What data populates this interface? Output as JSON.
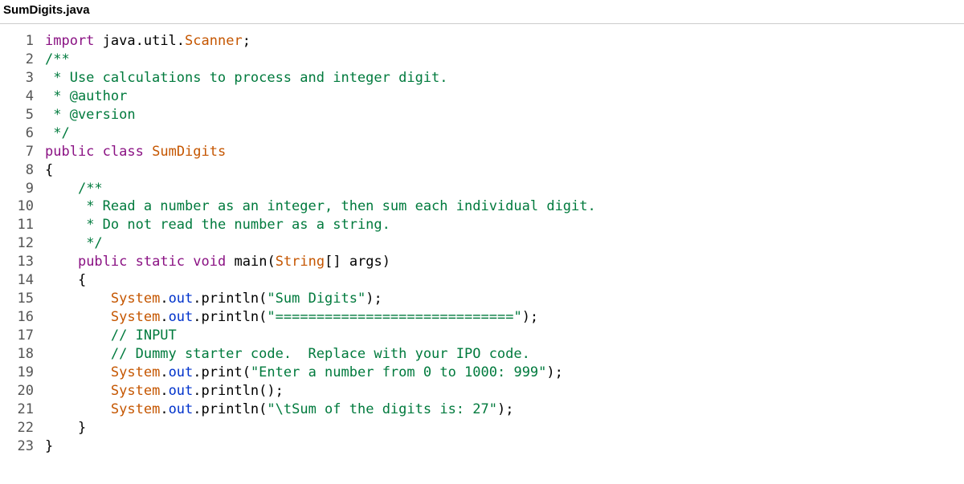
{
  "filename": "SumDigits.java",
  "lines": [
    {
      "n": "1",
      "tokens": [
        {
          "c": "kw",
          "t": "import"
        },
        {
          "c": "punct",
          "t": " "
        },
        {
          "c": "pkg",
          "t": "java.util."
        },
        {
          "c": "cls",
          "t": "Scanner"
        },
        {
          "c": "punct",
          "t": ";"
        }
      ]
    },
    {
      "n": "2",
      "tokens": [
        {
          "c": "comment",
          "t": "/**"
        }
      ]
    },
    {
      "n": "3",
      "tokens": [
        {
          "c": "comment",
          "t": " * Use calculations to process and integer digit."
        }
      ]
    },
    {
      "n": "4",
      "tokens": [
        {
          "c": "comment",
          "t": " * @author"
        }
      ]
    },
    {
      "n": "5",
      "tokens": [
        {
          "c": "comment",
          "t": " * @version"
        }
      ]
    },
    {
      "n": "6",
      "tokens": [
        {
          "c": "comment",
          "t": " */"
        }
      ]
    },
    {
      "n": "7",
      "tokens": [
        {
          "c": "kw",
          "t": "public"
        },
        {
          "c": "punct",
          "t": " "
        },
        {
          "c": "kw",
          "t": "class"
        },
        {
          "c": "punct",
          "t": " "
        },
        {
          "c": "cls",
          "t": "SumDigits"
        }
      ]
    },
    {
      "n": "8",
      "tokens": [
        {
          "c": "punct",
          "t": "{"
        }
      ]
    },
    {
      "n": "9",
      "tokens": [
        {
          "c": "punct",
          "t": "    "
        },
        {
          "c": "comment",
          "t": "/**"
        }
      ]
    },
    {
      "n": "10",
      "tokens": [
        {
          "c": "punct",
          "t": "    "
        },
        {
          "c": "comment",
          "t": " * Read a number as an integer, then sum each individual digit."
        }
      ]
    },
    {
      "n": "11",
      "tokens": [
        {
          "c": "punct",
          "t": "    "
        },
        {
          "c": "comment",
          "t": " * Do not read the number as a string."
        }
      ]
    },
    {
      "n": "12",
      "tokens": [
        {
          "c": "punct",
          "t": "    "
        },
        {
          "c": "comment",
          "t": " */"
        }
      ]
    },
    {
      "n": "13",
      "tokens": [
        {
          "c": "punct",
          "t": "    "
        },
        {
          "c": "kw",
          "t": "public"
        },
        {
          "c": "punct",
          "t": " "
        },
        {
          "c": "kw",
          "t": "static"
        },
        {
          "c": "punct",
          "t": " "
        },
        {
          "c": "kw",
          "t": "void"
        },
        {
          "c": "punct",
          "t": " "
        },
        {
          "c": "mname",
          "t": "main"
        },
        {
          "c": "punct",
          "t": "("
        },
        {
          "c": "cls",
          "t": "String"
        },
        {
          "c": "punct",
          "t": "[] args)"
        }
      ]
    },
    {
      "n": "14",
      "tokens": [
        {
          "c": "punct",
          "t": "    {"
        }
      ]
    },
    {
      "n": "15",
      "tokens": [
        {
          "c": "punct",
          "t": "        "
        },
        {
          "c": "cls",
          "t": "System"
        },
        {
          "c": "punct",
          "t": "."
        },
        {
          "c": "fld",
          "t": "out"
        },
        {
          "c": "punct",
          "t": ".println("
        },
        {
          "c": "str",
          "t": "\"Sum Digits\""
        },
        {
          "c": "punct",
          "t": ");"
        }
      ]
    },
    {
      "n": "16",
      "tokens": [
        {
          "c": "punct",
          "t": "        "
        },
        {
          "c": "cls",
          "t": "System"
        },
        {
          "c": "punct",
          "t": "."
        },
        {
          "c": "fld",
          "t": "out"
        },
        {
          "c": "punct",
          "t": ".println("
        },
        {
          "c": "str",
          "t": "\"=============================\""
        },
        {
          "c": "punct",
          "t": ");"
        }
      ]
    },
    {
      "n": "17",
      "tokens": [
        {
          "c": "punct",
          "t": "        "
        },
        {
          "c": "comment",
          "t": "// INPUT"
        }
      ]
    },
    {
      "n": "18",
      "tokens": [
        {
          "c": "punct",
          "t": "        "
        },
        {
          "c": "comment",
          "t": "// Dummy starter code.  Replace with your IPO code."
        }
      ]
    },
    {
      "n": "19",
      "tokens": [
        {
          "c": "punct",
          "t": "        "
        },
        {
          "c": "cls",
          "t": "System"
        },
        {
          "c": "punct",
          "t": "."
        },
        {
          "c": "fld",
          "t": "out"
        },
        {
          "c": "punct",
          "t": ".print("
        },
        {
          "c": "str",
          "t": "\"Enter a number from 0 to 1000: 999\""
        },
        {
          "c": "punct",
          "t": ");"
        }
      ]
    },
    {
      "n": "20",
      "tokens": [
        {
          "c": "punct",
          "t": "        "
        },
        {
          "c": "cls",
          "t": "System"
        },
        {
          "c": "punct",
          "t": "."
        },
        {
          "c": "fld",
          "t": "out"
        },
        {
          "c": "punct",
          "t": ".println();"
        }
      ]
    },
    {
      "n": "21",
      "tokens": [
        {
          "c": "punct",
          "t": "        "
        },
        {
          "c": "cls",
          "t": "System"
        },
        {
          "c": "punct",
          "t": "."
        },
        {
          "c": "fld",
          "t": "out"
        },
        {
          "c": "punct",
          "t": ".println("
        },
        {
          "c": "str",
          "t": "\"\\tSum of the digits is: 27\""
        },
        {
          "c": "punct",
          "t": ");"
        }
      ]
    },
    {
      "n": "22",
      "tokens": [
        {
          "c": "punct",
          "t": "    }"
        }
      ]
    },
    {
      "n": "23",
      "tokens": [
        {
          "c": "punct",
          "t": "}"
        }
      ]
    }
  ]
}
